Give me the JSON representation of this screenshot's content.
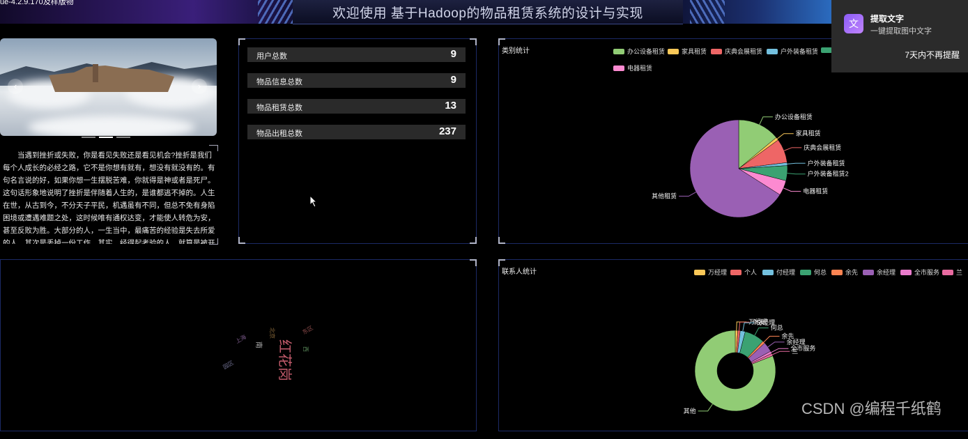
{
  "app": {
    "title": "欢迎使用 基于Hadoop的物品租赁系统的设计与实现",
    "top_left_text": "ue-4.2.9.170及样版物"
  },
  "carousel": {
    "prev": "‹",
    "next": "›",
    "slide_count": 3,
    "active_index": 1
  },
  "intro_text": "当遇到挫折或失败，你是看见失败还是看见机会?挫折是我们每个人成长的必经之路，它不是你想有就有，想没有就没有的。有句名言说的好，如果你想一生摆脱苦难，你就得是神或者是死尸。这句话形象地说明了挫折是伴随着人生的，是谁都逃不掉的。人生在世，从古到今，不分天子平民，机遇虽有不同，但总不免有身陷困境或遭遇难题之处，这时候唯有通权达变，才能使人转危为安，甚至反败为胜。大部分的人，一生当中，最痛苦的经验是失去所爱的人，其次是丢掉一份工作。其实，经得起考验的人，就算是被开除也不会惊慌",
  "stats": [
    {
      "label": "用户总数",
      "value": "9"
    },
    {
      "label": "物品信息总数",
      "value": "9"
    },
    {
      "label": "物品租赁总数",
      "value": "13"
    },
    {
      "label": "物品出租总数",
      "value": "237"
    }
  ],
  "category_chart": {
    "title": "类别统计",
    "legend": [
      {
        "name": "办公设备租赁",
        "color": "#91cc75"
      },
      {
        "name": "家具租赁",
        "color": "#fac858"
      },
      {
        "name": "庆典会展租赁",
        "color": "#ee6666"
      },
      {
        "name": "户外装备租赁",
        "color": "#73c0de"
      },
      {
        "name": "",
        "color": "#3ba272"
      },
      {
        "name": "电器租赁",
        "color": "#fc8ad1"
      }
    ]
  },
  "contact_chart": {
    "title": "联系人统计",
    "legend": [
      {
        "name": "万经理",
        "color": "#fac858"
      },
      {
        "name": "个人",
        "color": "#ee6666"
      },
      {
        "name": "付经理",
        "color": "#73c0de"
      },
      {
        "name": "何总",
        "color": "#3ba272"
      },
      {
        "name": "余先",
        "color": "#fc8452"
      },
      {
        "name": "余经理",
        "color": "#9a60b4"
      },
      {
        "name": "全市服务",
        "color": "#ea7ccc"
      },
      {
        "name": "兰",
        "color": "#e86ba0"
      }
    ]
  },
  "chart_data": [
    {
      "type": "pie",
      "title": "类别统计",
      "categories": [
        "办公设备租赁",
        "家具租赁",
        "庆典会展租赁",
        "户外装备租赁",
        "户外装备租赁2",
        "电器租赁",
        "其他租赁"
      ],
      "values": [
        14,
        1,
        8,
        1,
        5,
        5,
        66
      ],
      "colors": [
        "#91cc75",
        "#fac858",
        "#ee6666",
        "#73c0de",
        "#3ba272",
        "#fc8ad1",
        "#9a60b4"
      ]
    },
    {
      "type": "pie",
      "title": "联系人统计",
      "categories": [
        "万经理",
        "个人",
        "付经理",
        "何总",
        "余先",
        "余经理",
        "全市服务",
        "兰",
        "其他"
      ],
      "values": [
        1,
        1,
        2,
        8,
        1,
        4,
        1,
        1,
        81
      ],
      "colors": [
        "#fac858",
        "#ee6666",
        "#73c0de",
        "#3ba272",
        "#fc8452",
        "#9a60b4",
        "#ea7ccc",
        "#e86ba0",
        "#91cc75"
      ]
    }
  ],
  "word_cloud": {
    "words": [
      {
        "text": "红花岗",
        "color": "#c05a6a"
      },
      {
        "text": "南",
        "color": "#b0b0b0"
      },
      {
        "text": "北京",
        "color": "#8a6a3a"
      },
      {
        "text": "西",
        "color": "#5a8a5a"
      },
      {
        "text": "上海",
        "color": "#7a5a8a"
      },
      {
        "text": "东区",
        "color": "#8a4a4a"
      },
      {
        "text": "园区",
        "color": "#6a6a8a"
      }
    ]
  },
  "toast": {
    "title": "提取文字",
    "subtitle": "一键提取图中文字",
    "dismiss": "7天内不再提醒",
    "icon_glyph": "文"
  },
  "watermark": "CSDN @编程千纸鹤"
}
